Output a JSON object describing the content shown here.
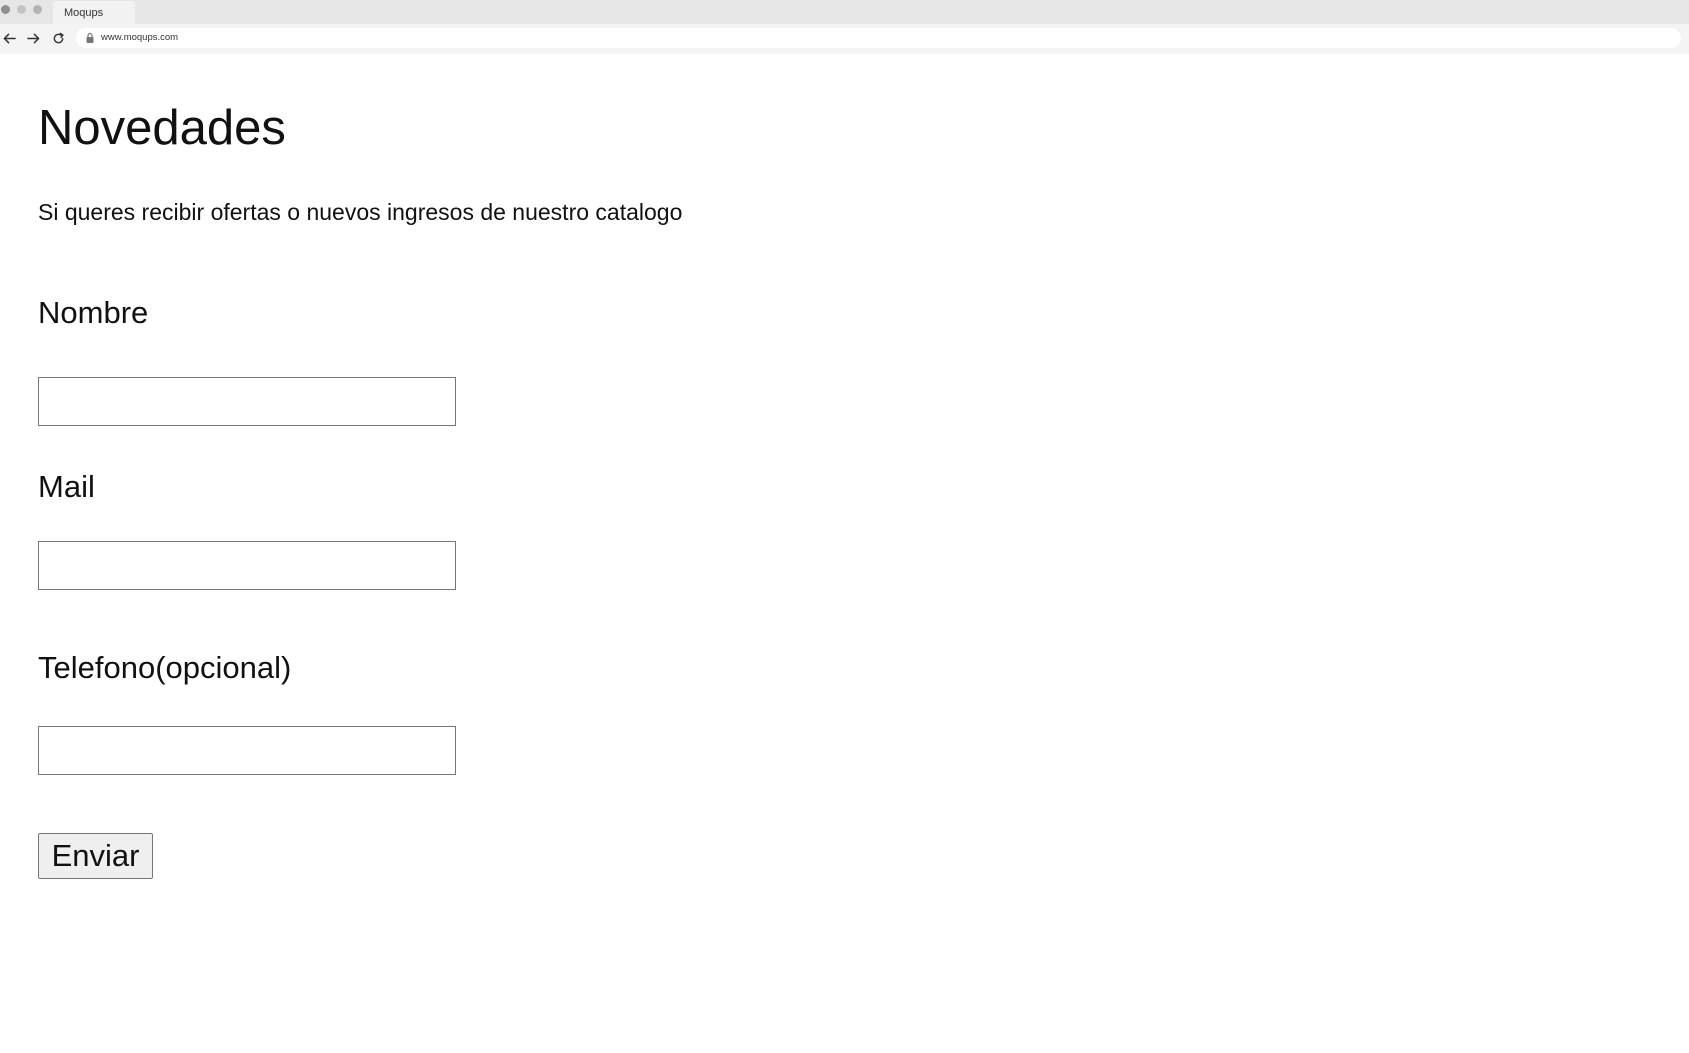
{
  "browser": {
    "tab_title": "Moqups",
    "url": "www.moqups.com",
    "icons": [
      "back-arrow-icon",
      "forward-arrow-icon",
      "reload-icon",
      "lock-icon"
    ]
  },
  "page": {
    "title": "Novedades",
    "subtitle": "Si queres recibir ofertas o nuevos ingresos de nuestro catalogo"
  },
  "form": {
    "nombre_label": "Nombre",
    "nombre_value": "",
    "mail_label": "Mail",
    "mail_value": "",
    "telefono_label": "Telefono(opcional)",
    "telefono_value": "",
    "submit_label": "Enviar"
  }
}
